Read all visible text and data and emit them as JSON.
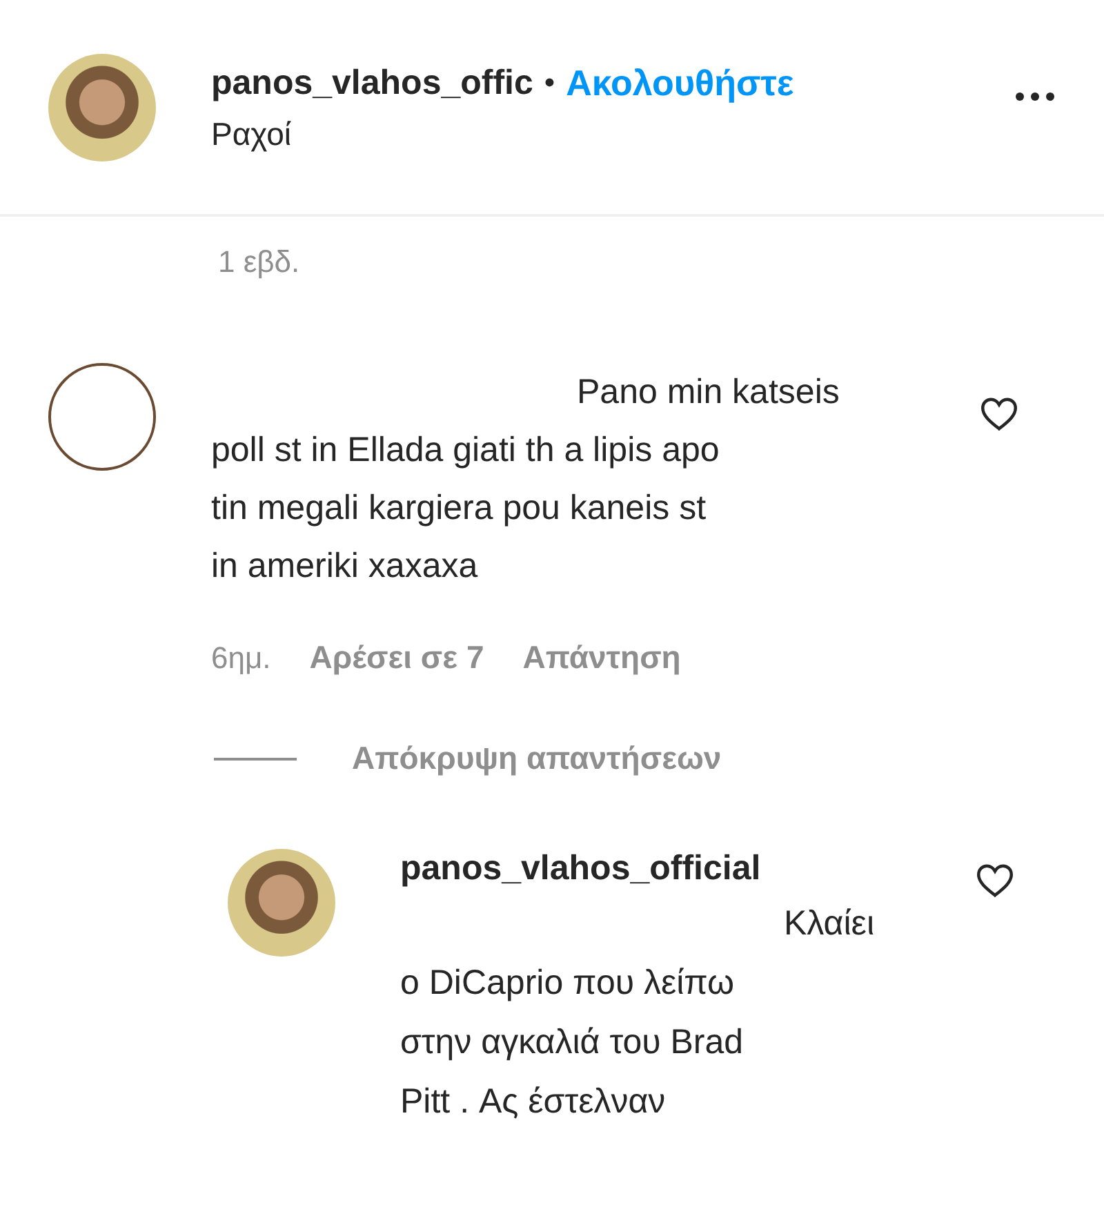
{
  "post_header": {
    "username": "panos_vlahos_offic",
    "separator": "•",
    "follow_label": "Ακολουθήστε",
    "location": "Ραχοί"
  },
  "post_age": "1 εβδ.",
  "comment": {
    "text_lines": [
      "Pano min katseis",
      "poll st in Ellada giati th a lipis apo",
      "tin megali kargiera pou kaneis st",
      "in ameriki xaxaxa"
    ],
    "liked": false,
    "age": "6ημ.",
    "likes": "Αρέσει σε 7",
    "reply_label": "Απάντηση"
  },
  "hide_replies": "Απόκρυψη απαντήσεων",
  "reply": {
    "username": "panos_vlahos_official",
    "text_lines": [
      "Κλαίει",
      "ο DiCaprio που λείπω",
      "στην αγκαλιά του Brad",
      "Pitt . Ας έστελναν"
    ],
    "liked": false
  }
}
